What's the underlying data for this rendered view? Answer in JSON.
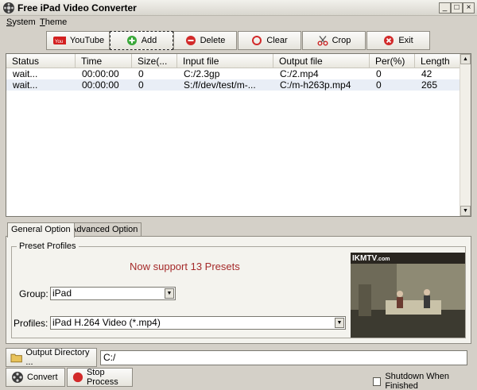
{
  "window": {
    "title": "Free iPad Video Converter",
    "controls": [
      "_",
      "□",
      "×"
    ]
  },
  "menu": [
    {
      "label_ul": "S",
      "label_rest": "ystem"
    },
    {
      "label_ul": "T",
      "label_rest": "heme"
    }
  ],
  "toolbar": [
    {
      "label": "YouTube",
      "icon": "youtube-icon"
    },
    {
      "label": "Add",
      "icon": "add-icon"
    },
    {
      "label": "Delete",
      "icon": "delete-icon"
    },
    {
      "label": "Clear",
      "icon": "clear-icon"
    },
    {
      "label": "Crop",
      "icon": "crop-icon"
    },
    {
      "label": "Exit",
      "icon": "exit-icon"
    }
  ],
  "file_list": {
    "columns": [
      "Status",
      "Time",
      "Size(...",
      "Input file",
      "Output file",
      "Per(%)",
      "Length"
    ],
    "rows": [
      [
        "wait...",
        "00:00:00",
        "0",
        "C:/2.3gp",
        "C:/2.mp4",
        "0",
        "42"
      ],
      [
        "wait...",
        "00:00:00",
        "0",
        "S:/f/dev/test/m-...",
        "C:/m-h263p.mp4",
        "0",
        "265"
      ]
    ]
  },
  "tabs": [
    "General Option",
    "Advanced Option"
  ],
  "preset_profiles": {
    "title": "Preset Profiles",
    "support_text": "Now support 13 Presets",
    "group_label": "Group:",
    "group_value": "iPad",
    "profiles_label": "Profiles:",
    "profiles_value": "iPad H.264 Video (*.mp4)",
    "preview_brand": "IKMTV",
    "preview_brand_suffix": ".com"
  },
  "output": {
    "dir_button": "Output Directory ...",
    "dir_value": "C:/"
  },
  "actions": {
    "convert": "Convert",
    "stop": "Stop Process",
    "shutdown": "Shutdown When Finished"
  },
  "colors": {
    "window_bg": "#d4d0c8",
    "support_text": "#a52a2a",
    "alt_row": "#e9eef6"
  }
}
